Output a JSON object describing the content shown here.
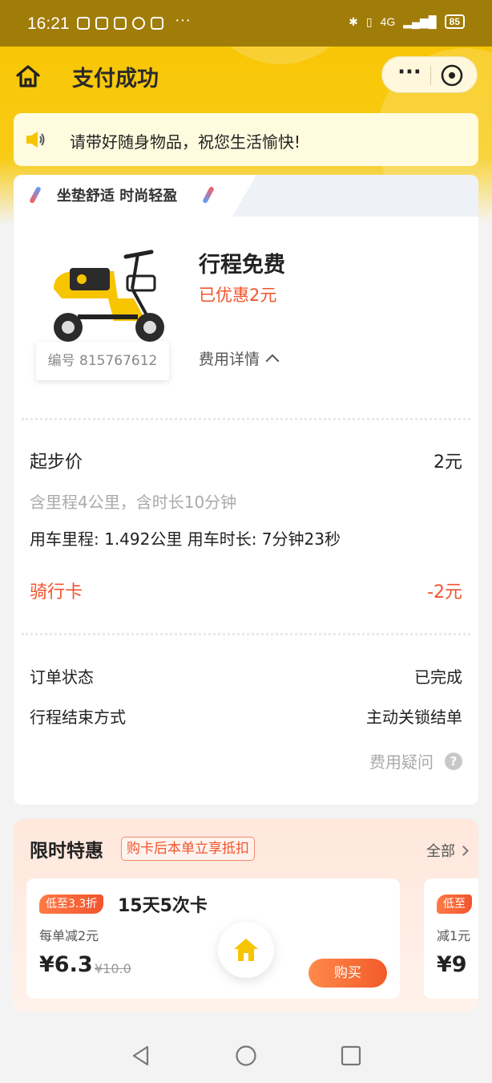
{
  "status_bar": {
    "time": "16:21",
    "more": "···",
    "battery": "85",
    "network": "4G"
  },
  "navbar": {
    "title": "支付成功"
  },
  "notice": {
    "text": "请带好随身物品，祝您生活愉快!"
  },
  "banner": {
    "text": "坐垫舒适 时尚轻盈"
  },
  "trip": {
    "bike_id": "编号 815767612",
    "title": "行程免费",
    "discount": "已优惠2元",
    "fee_detail": "费用详情"
  },
  "fees": {
    "base_label": "起步价",
    "base_value": "2元",
    "base_note": "含里程4公里，含时长10分钟",
    "usage": "用车里程: 1.492公里 用车时长: 7分钟23秒",
    "card_label": "骑行卡",
    "card_value": "-2元"
  },
  "order": {
    "status_label": "订单状态",
    "status_value": "已完成",
    "end_label": "行程结束方式",
    "end_value": "主动关锁结单",
    "question": "费用疑问",
    "question_icon": "?"
  },
  "promo": {
    "title": "限时特惠",
    "tag": "购卡后本单立享抵扣",
    "all": "全部",
    "offers": [
      {
        "badge": "低至3.3折",
        "name": "15天5次卡",
        "sub": "每单减2元",
        "price": "¥6.3",
        "original": "¥10.0",
        "buy": "购买"
      },
      {
        "badge": "低至",
        "sub": "减1元",
        "price": "¥9"
      }
    ]
  },
  "colors": {
    "brand_yellow": "#f7c400",
    "accent_orange": "#f2542d"
  }
}
